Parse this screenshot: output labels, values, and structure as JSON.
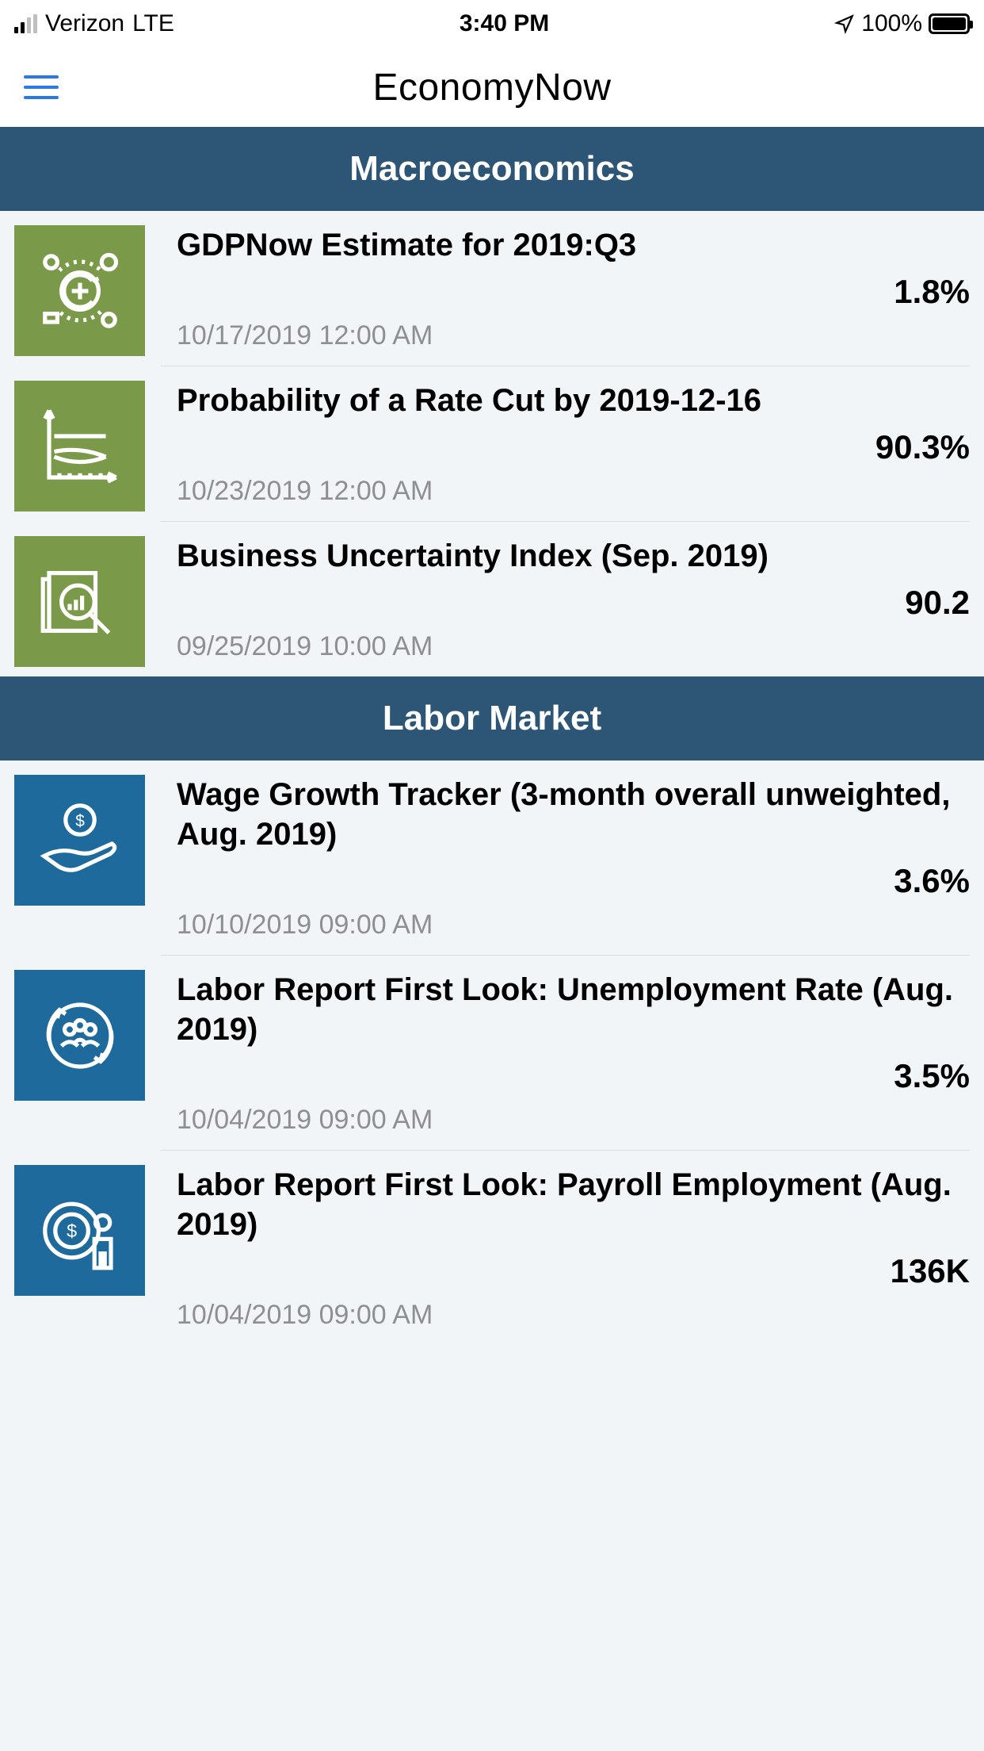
{
  "status_bar": {
    "carrier": "Verizon",
    "network": "LTE",
    "time": "3:40 PM",
    "battery_pct": "100%"
  },
  "header": {
    "title": "EconomyNow"
  },
  "sections": [
    {
      "title": "Macroeconomics",
      "color": "green",
      "items": [
        {
          "icon": "cycle",
          "title": "GDPNow Estimate for 2019:Q3",
          "value": "1.8%",
          "date": "10/17/2019 12:00 AM"
        },
        {
          "icon": "chart",
          "title": "Probability of a Rate Cut by 2019-12-16",
          "value": "90.3%",
          "date": "10/23/2019 12:00 AM"
        },
        {
          "icon": "magnifier",
          "title": "Business Uncertainty Index (Sep. 2019)",
          "value": "90.2",
          "date": "09/25/2019 10:00 AM"
        }
      ]
    },
    {
      "title": "Labor Market",
      "color": "blue",
      "items": [
        {
          "icon": "hand-coin",
          "title": "Wage Growth Tracker (3-month overall unweighted, Aug. 2019)",
          "value": "3.6%",
          "date": "10/10/2019 09:00 AM"
        },
        {
          "icon": "people",
          "title": "Labor Report First Look: Unemployment Rate (Aug. 2019)",
          "value": "3.5%",
          "date": "10/04/2019 09:00 AM"
        },
        {
          "icon": "coin-man",
          "title": "Labor Report First Look: Payroll Employment (Aug. 2019)",
          "value": "136K",
          "date": "10/04/2019 09:00 AM"
        }
      ]
    }
  ]
}
